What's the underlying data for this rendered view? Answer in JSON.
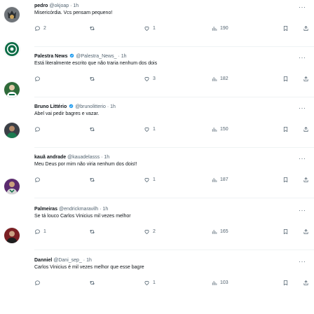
{
  "icons": {
    "reply": "speech-bubble",
    "retweet": "two-arrows-loop",
    "like": "heart",
    "views": "bar-chart",
    "bookmark": "bookmark",
    "share": "upload-arrow",
    "more": "three-dots",
    "verified": "verified-badge"
  },
  "colors": {
    "text": "#0f1419",
    "secondary": "#536471",
    "verified_badge": "#1d9bf0"
  },
  "tweets": [
    {
      "name": "pedro",
      "handle": "@okjoap",
      "separator": "·",
      "time": "1h",
      "verified": false,
      "text": "Misericórdia. Vcs pensam pequeno!",
      "replies": "2",
      "retweets": "",
      "likes": "1",
      "views": "190",
      "avatar": "dark-fox"
    },
    {
      "name": "Palestra News",
      "handle": "@Palestra_News_",
      "separator": "·",
      "time": "1h",
      "verified": true,
      "text": "Está literalmente escrito que não traria nenhum dos dois",
      "replies": "",
      "retweets": "",
      "likes": "3",
      "views": "182",
      "avatar": "palmeiras-crest"
    },
    {
      "name": "Bruno Littério",
      "handle": "@brunolitterio",
      "separator": "·",
      "time": "1h",
      "verified": true,
      "text": "Abel vai pedir bagres e vazar.",
      "replies": "",
      "retweets": "",
      "likes": "1",
      "views": "150",
      "avatar": "person-green"
    },
    {
      "name": "kauã andrade",
      "handle": "@kauadelasss",
      "separator": "·",
      "time": "1h",
      "verified": false,
      "text": "Meu Deus por mim não viria nenhum dos dois!!",
      "replies": "",
      "retweets": "",
      "likes": "1",
      "views": "187",
      "avatar": "person-dark"
    },
    {
      "name": "Palmeiras",
      "handle": "@endrickmaravilh",
      "separator": "·",
      "time": "1h",
      "verified": false,
      "text": "Se tá louco Carlos Vinicius mil vezes melhor",
      "replies": "1",
      "retweets": "",
      "likes": "2",
      "views": "165",
      "avatar": "player-purple"
    },
    {
      "name": "Danniel",
      "handle": "@Dani_sep_",
      "separator": "·",
      "time": "1h",
      "verified": false,
      "text": "Carlos Vinicius é mil vezes melhor que esse bagre",
      "replies": "",
      "retweets": "",
      "likes": "1",
      "views": "103",
      "avatar": "person-red"
    }
  ]
}
